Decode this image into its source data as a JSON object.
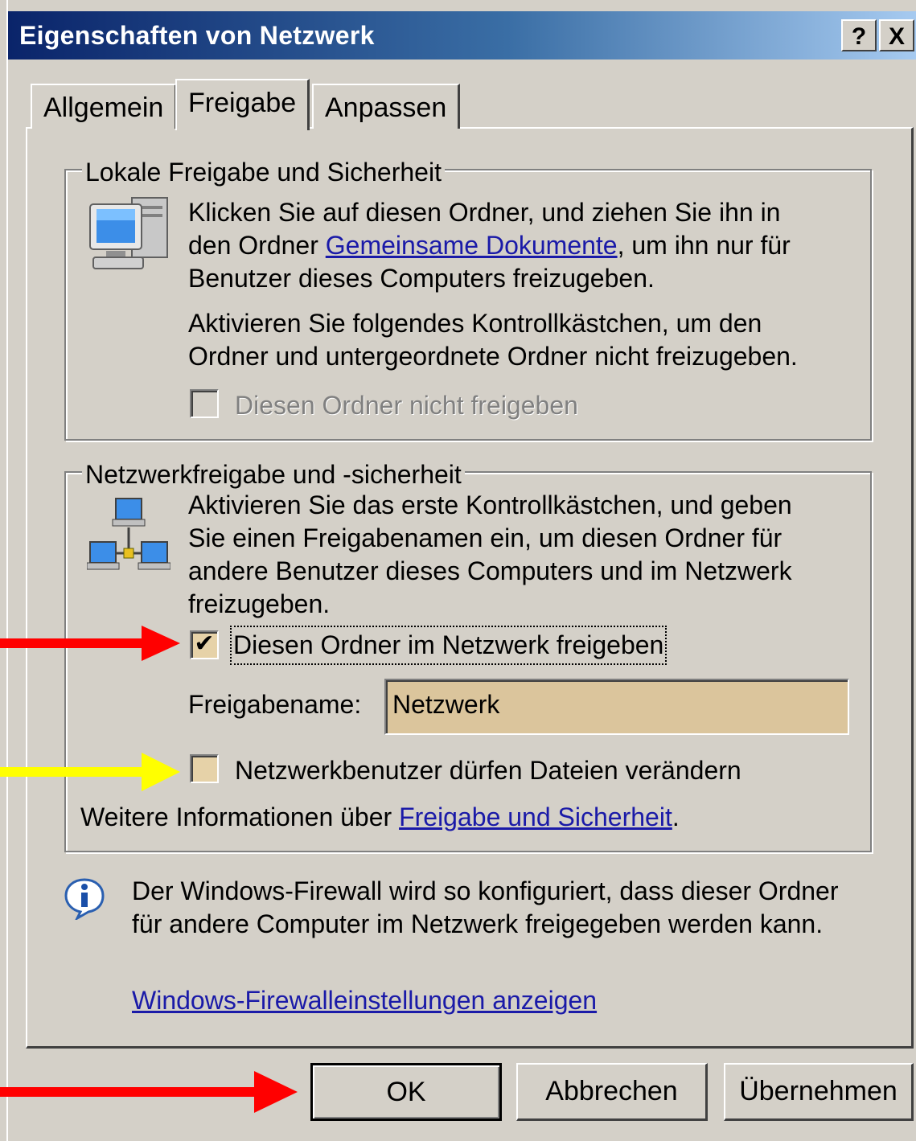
{
  "window": {
    "title": "Eigenschaften von Netzwerk",
    "help_button": "?",
    "close_button": "X"
  },
  "tabs": [
    {
      "label": "Allgemein",
      "selected": false
    },
    {
      "label": "Freigabe",
      "selected": true
    },
    {
      "label": "Anpassen",
      "selected": false
    }
  ],
  "local_group": {
    "legend": "Lokale Freigabe und Sicherheit",
    "icon": "computer-icon",
    "line1": "Klicken Sie auf diesen Ordner, und ziehen Sie ihn in",
    "line2_before": "den Ordner ",
    "line2_link": "Gemeinsame Dokumente",
    "line2_after": ", um ihn nur für",
    "line3": "Benutzer dieses Computers freizugeben.",
    "line4": "Aktivieren Sie folgendes Kontrollkästchen, um den",
    "line5": "Ordner und untergeordnete Ordner nicht freizugeben.",
    "checkbox_label": "Diesen Ordner nicht freigeben",
    "checkbox_checked": false,
    "checkbox_enabled": false
  },
  "network_group": {
    "legend": "Netzwerkfreigabe und -sicherheit",
    "icon": "network-icon",
    "line1": "Aktivieren Sie das erste Kontrollkästchen, und geben",
    "line2": "Sie einen Freigabenamen ein, um diesen Ordner für",
    "line3": "andere Benutzer dieses Computers und im Netzwerk",
    "line4": "freizugeben.",
    "share_checkbox_label": "Diesen Ordner im Netzwerk freigeben",
    "share_checkbox_checked": true,
    "share_name_label": "Freigabename:",
    "share_name_value": "Netzwerk",
    "modify_checkbox_label": "Netzwerkbenutzer dürfen Dateien verändern",
    "modify_checkbox_checked": false,
    "more_info_before": "Weitere Informationen über ",
    "more_info_link": "Freigabe und Sicherheit",
    "more_info_after": "."
  },
  "firewall": {
    "icon": "info-icon",
    "line1": "Der Windows-Firewall wird so konfiguriert, dass dieser Ordner",
    "line2": "für andere Computer im Netzwerk freigegeben werden kann.",
    "link": "Windows-Firewalleinstellungen anzeigen"
  },
  "buttons": {
    "ok": "OK",
    "cancel": "Abbrechen",
    "apply": "Übernehmen"
  },
  "colors": {
    "arrow_red": "#ff0000",
    "arrow_yellow": "#ffff00",
    "title_gradient_start": "#0a246a",
    "title_gradient_end": "#a6caf0",
    "dialog_face": "#d4d0c8"
  }
}
